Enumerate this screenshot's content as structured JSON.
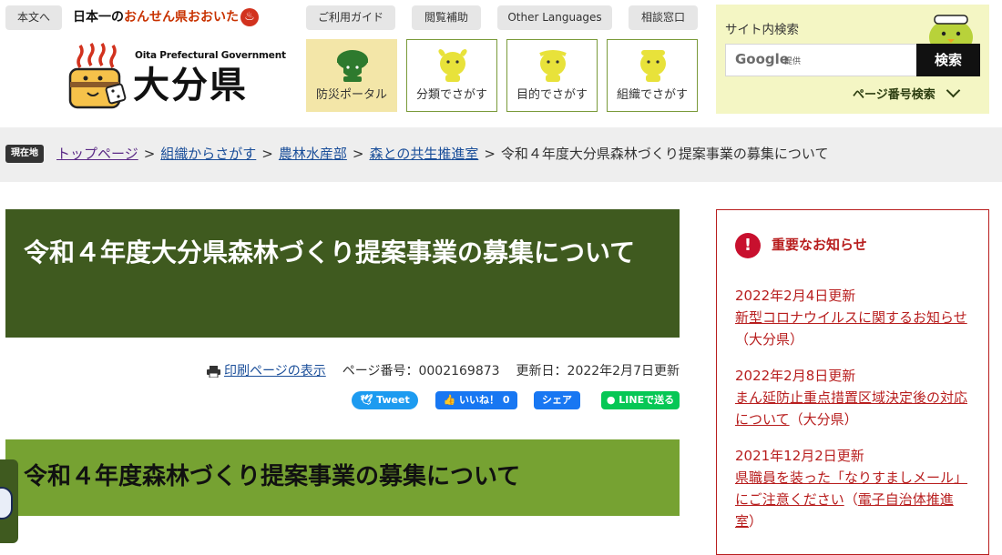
{
  "header": {
    "skip_link": "本文へ",
    "tagline_prefix": "日本一の",
    "tagline_highlight": "おんせん県おおいた",
    "tagline_mark": "♨",
    "logo_en": "Oita Prefectural Government",
    "logo_jp": "大分県",
    "utility": {
      "guide": "ご利用ガイド",
      "accessibility": "閲覧補助",
      "languages": "Other Languages",
      "consult": "相談窓口"
    },
    "nav_tiles": [
      {
        "label": "防災ポータル",
        "icon": "mascot-helmet-icon"
      },
      {
        "label": "分類でさがす",
        "icon": "mascot-icon"
      },
      {
        "label": "目的でさがす",
        "icon": "mascot-icon"
      },
      {
        "label": "組織でさがす",
        "icon": "mascot-icon"
      }
    ],
    "search": {
      "title": "サイト内検索",
      "google_label": "Google",
      "google_sub": "提供",
      "button": "検索",
      "page_number_search": "ページ番号検索"
    }
  },
  "breadcrumb": {
    "badge": "現在地",
    "items": [
      "トップページ",
      "組織からさがす",
      "農林水産部",
      "森との共生推進室"
    ],
    "current": "令和４年度大分県森林づくり提案事業の募集について",
    "separator": ">"
  },
  "main": {
    "title": "令和４年度大分県森林づくり提案事業の募集について",
    "print_link": "印刷ページの表示",
    "page_number": "ページ番号：0002169873",
    "updated": "更新日：2022年2月7日更新",
    "share": {
      "tweet": "Tweet",
      "like": "いいね！ 0",
      "share": "シェア",
      "line": "LINEで送る"
    },
    "subtitle": "令和４年度森林づくり提案事業の募集について"
  },
  "notices": {
    "heading": "重要なお知らせ",
    "icon": "!",
    "items": [
      {
        "date": "2022年2月4日更新",
        "link": "新型コロナウイルスに関するお知らせ",
        "source": "（大分県）"
      },
      {
        "date": "2022年2月8日更新",
        "link": "まん延防止重点措置区域決定後の対応について",
        "source": "（大分県）"
      },
      {
        "date": "2021年12月2日更新",
        "link": "県職員を装った「なりすましメール」にご注意ください",
        "source": "（",
        "source_link": "電子自治体推進室",
        "source_end": "）"
      }
    ]
  },
  "colors": {
    "dark_green": "#3f5a1f",
    "light_green": "#76a232",
    "notice_red": "#b81e1e",
    "search_bg": "#f4f6c4",
    "disaster_tile_bg": "#f3e6a8"
  }
}
